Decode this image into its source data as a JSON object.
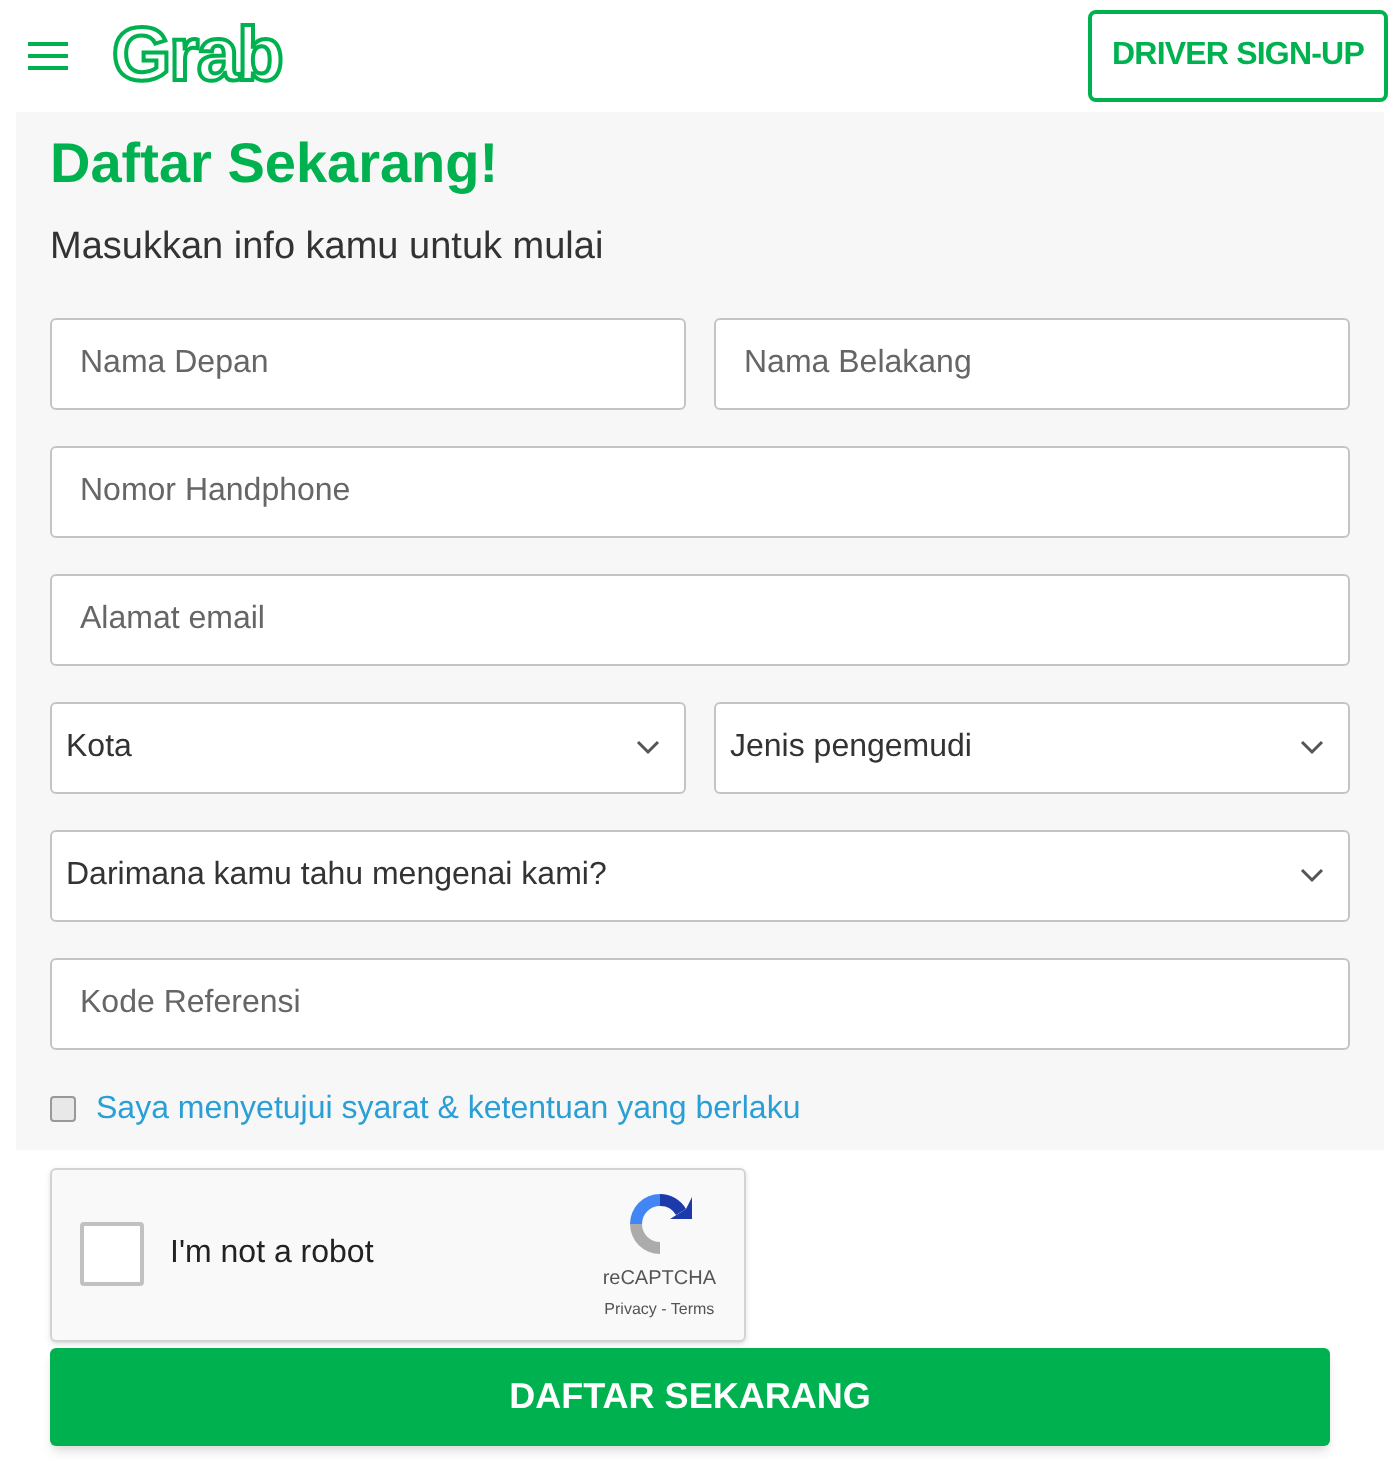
{
  "header": {
    "logo": "Grab",
    "driver_button": "DRIVER SIGN-UP"
  },
  "heading": "Daftar Sekarang!",
  "subheading": "Masukkan info kamu untuk mulai",
  "field_rows": [
    [
      {
        "kind": "input",
        "placeholder": "Nama Depan"
      },
      {
        "kind": "input",
        "placeholder": "Nama Belakang"
      }
    ],
    [
      {
        "kind": "input",
        "placeholder": "Nomor Handphone"
      }
    ],
    [
      {
        "kind": "input",
        "placeholder": "Alamat email"
      }
    ],
    [
      {
        "kind": "select",
        "value": "Kota"
      },
      {
        "kind": "select",
        "value": "Jenis pengemudi"
      }
    ],
    [
      {
        "kind": "select",
        "value": "Darimana kamu tahu mengenai kami?"
      }
    ],
    [
      {
        "kind": "input",
        "placeholder": "Kode Referensi"
      }
    ]
  ],
  "agreement": {
    "label": "Saya menyetujui syarat & ketentuan yang berlaku",
    "checked": false
  },
  "captcha": {
    "label": "I'm not a robot",
    "checked": false,
    "brand": "reCAPTCHA",
    "links": "Privacy - Terms"
  },
  "submit": "DAFTAR SEKARANG"
}
